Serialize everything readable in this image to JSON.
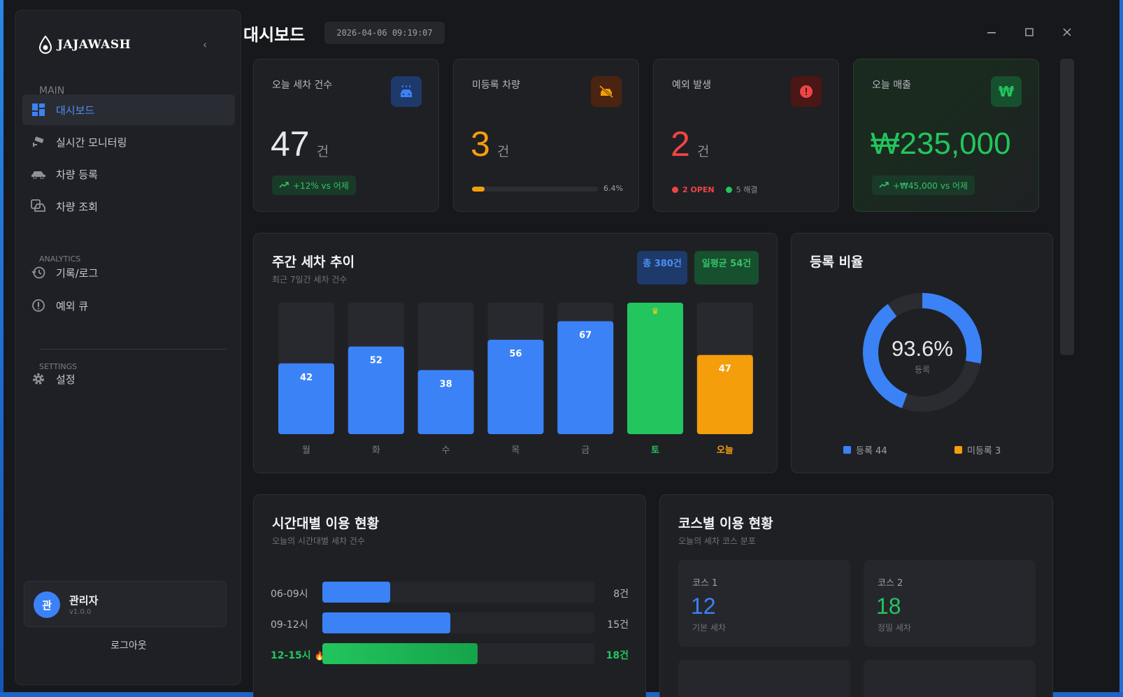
{
  "app": {
    "brand": "JAJAWASH"
  },
  "header": {
    "title": "대시보드",
    "datetime": "2026-04-06 09:19:07"
  },
  "sidebar": {
    "sections": {
      "main": "MAIN",
      "analytics": "ANALYTICS",
      "settings": "SETTINGS"
    },
    "items": [
      {
        "label": "대시보드",
        "icon": "dashboard-icon",
        "active": true
      },
      {
        "label": "실시간 모니터링",
        "icon": "cctv-icon"
      },
      {
        "label": "차량 등록",
        "icon": "car-add-icon"
      },
      {
        "label": "차량 조회",
        "icon": "car-search-icon"
      },
      {
        "label": "기록/로그",
        "icon": "history-icon"
      },
      {
        "label": "예외 큐",
        "icon": "alert-circle-icon"
      },
      {
        "label": "설정",
        "icon": "gear-icon"
      }
    ],
    "user": {
      "avatar": "관",
      "name": "관리자",
      "version": "v1.0.0"
    },
    "logout": "로그아웃"
  },
  "stats": [
    {
      "label": "오늘 세차 건수",
      "value": "47",
      "unit": "건",
      "trend": "+12% vs 어제",
      "icon": "car-wash-icon",
      "color": "#e6e8ec"
    },
    {
      "label": "미등록 차량",
      "value": "3",
      "unit": "건",
      "progress_text": "6.4%",
      "progress": 0.064,
      "icon": "car-off-icon",
      "color": "#f59e0b"
    },
    {
      "label": "예외 발생",
      "value": "2",
      "unit": "건",
      "open": "2 OPEN",
      "resolved": "5 해결",
      "icon": "alert-icon",
      "color": "#ef4444"
    },
    {
      "label": "오늘 매출",
      "value": "₩235,000",
      "trend": "+₩45,000 vs 어제",
      "icon": "won-icon",
      "color": "#22c55e"
    }
  ],
  "weekly": {
    "title": "주간 세차 추이",
    "subtitle": "최근 7일간 세차 건수",
    "total": "총 380건",
    "average": "일평균 54건"
  },
  "ratio": {
    "title": "등록 비율",
    "percent": "93.6%",
    "center_label": "등록",
    "legend_registered": "등록 44",
    "legend_unregistered": "미등록 3"
  },
  "hourly": {
    "title": "시간대별 이용 현황",
    "subtitle": "오늘의 시간대별 세차 건수",
    "rows": [
      {
        "label": "06-09시",
        "value": "8건",
        "fraction": 0.25,
        "color": "#3b82f6",
        "highlight": false
      },
      {
        "label": "09-12시",
        "value": "15건",
        "fraction": 0.47,
        "color": "#3b82f6",
        "highlight": false
      },
      {
        "label": "12-15시",
        "value": "18건",
        "fraction": 0.57,
        "color": "#22c55e",
        "highlight": true
      }
    ]
  },
  "courses": {
    "title": "코스별 이용 현황",
    "subtitle": "오늘의 세차 코스 분포",
    "items": [
      {
        "name": "코스 1",
        "count": "12",
        "desc": "기본 세차",
        "color": "#3b82f6"
      },
      {
        "name": "코스 2",
        "count": "18",
        "desc": "정밀 세차",
        "color": "#22c55e"
      }
    ]
  },
  "chart_data": [
    {
      "type": "bar",
      "title": "주간 세차 추이",
      "categories": [
        "월",
        "화",
        "수",
        "목",
        "금",
        "토",
        "오늘"
      ],
      "values": [
        42,
        52,
        38,
        56,
        67,
        78,
        47
      ],
      "value_labels": [
        "42",
        "52",
        "38",
        "56",
        "67",
        "",
        "47"
      ],
      "ylim": [
        0,
        78
      ],
      "colors": [
        "#3b82f6",
        "#3b82f6",
        "#3b82f6",
        "#3b82f6",
        "#3b82f6",
        "#22c55e",
        "#f59e0b"
      ],
      "label_colors": [
        "#7c7f86",
        "#7c7f86",
        "#7c7f86",
        "#7c7f86",
        "#7c7f86",
        "#22c55e",
        "#f59e0b"
      ],
      "grid": false
    },
    {
      "type": "pie",
      "title": "등록 비율",
      "categories": [
        "등록",
        "미등록"
      ],
      "values": [
        44,
        3
      ],
      "colors": [
        "#3b82f6",
        "#2b2c31"
      ]
    }
  ]
}
